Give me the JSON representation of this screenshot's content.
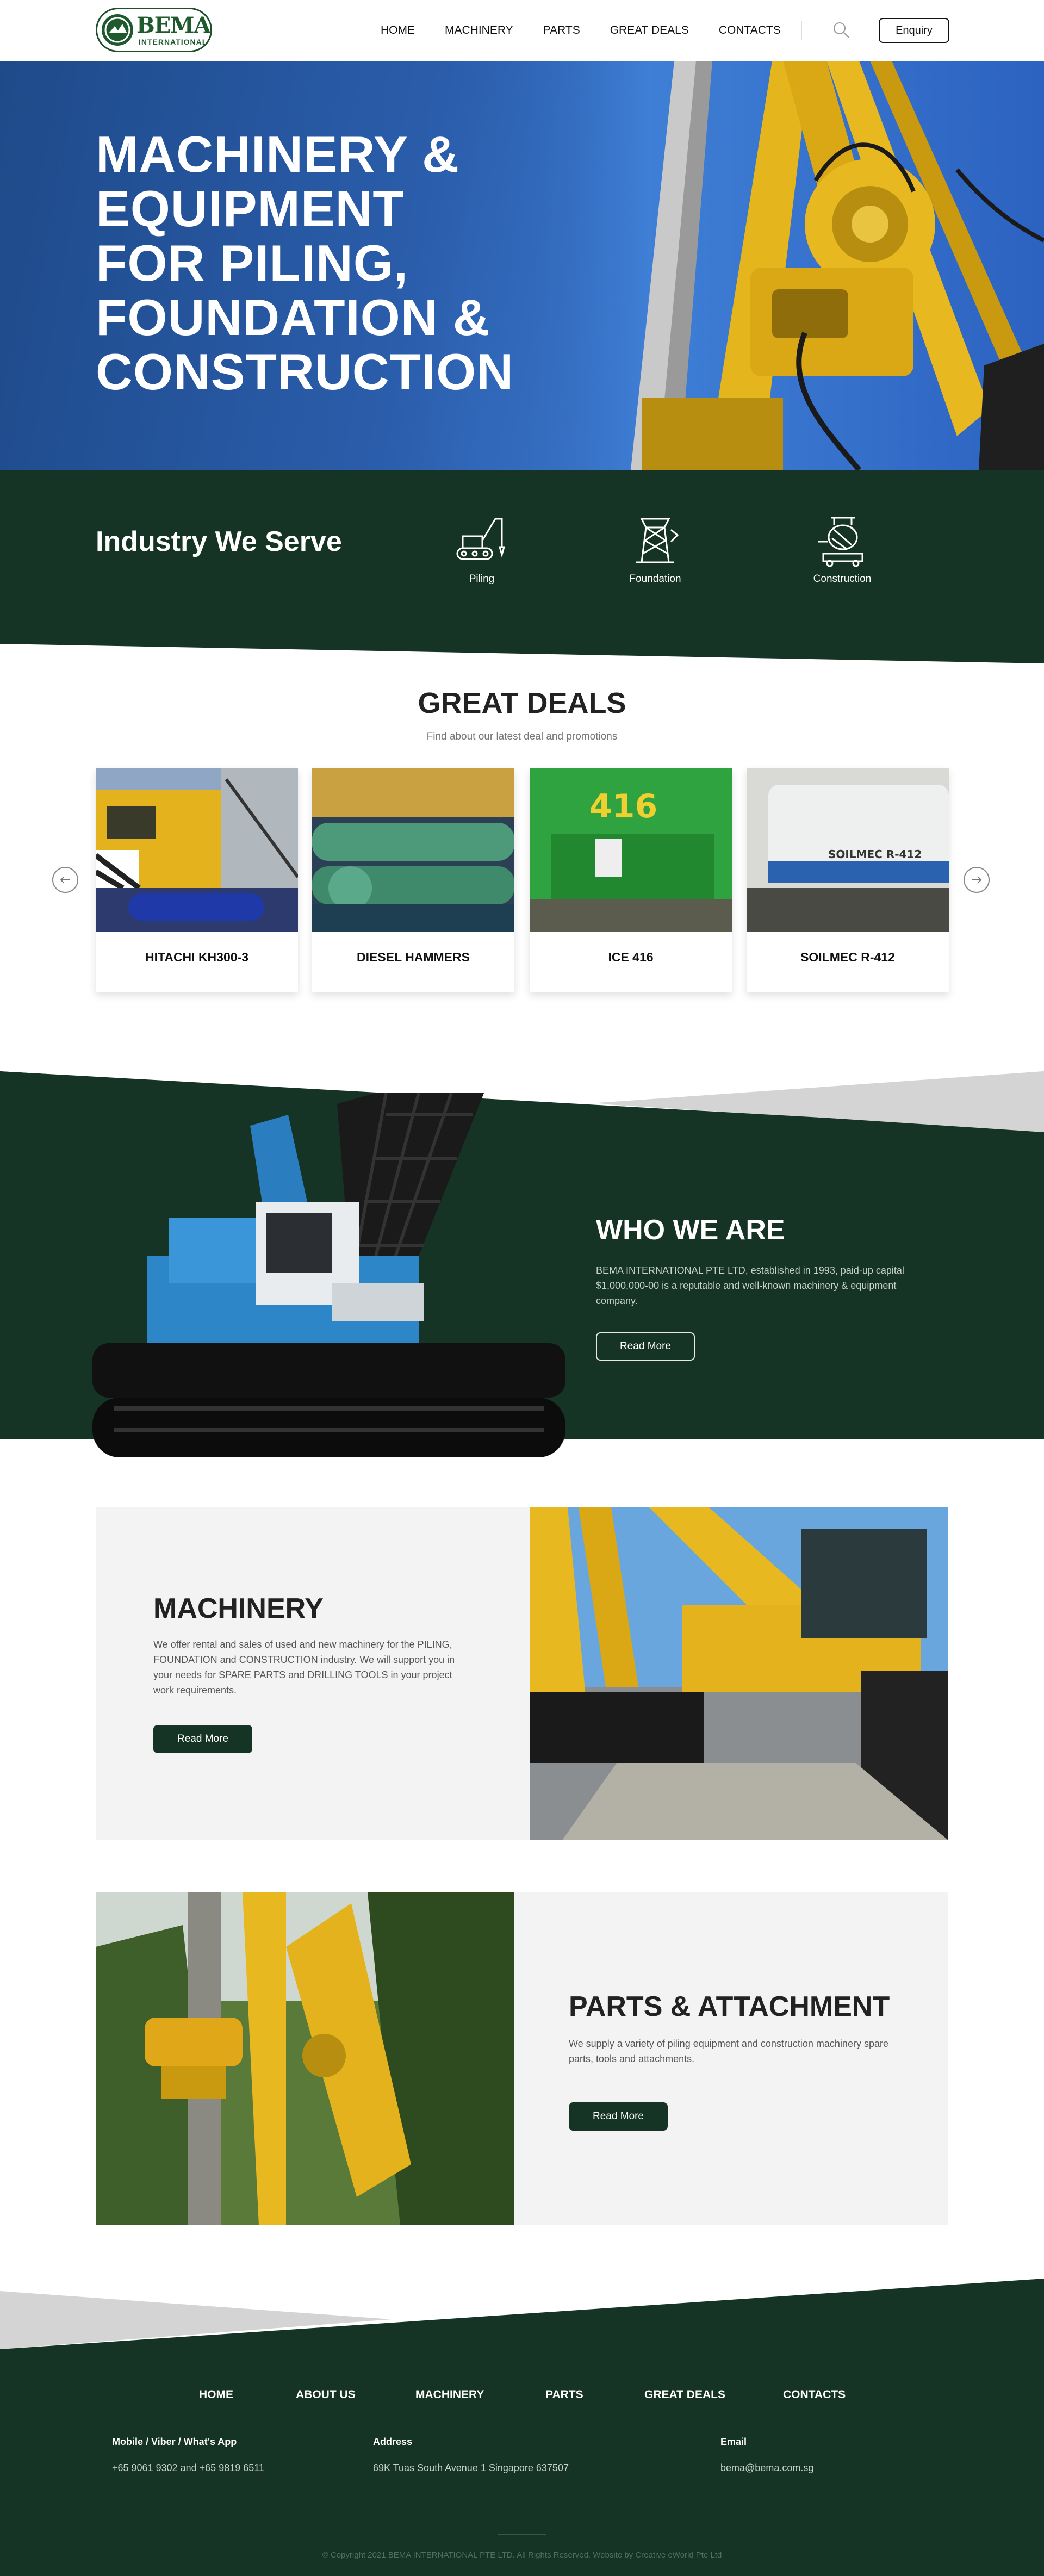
{
  "header": {
    "logo_word": "BEMA",
    "logo_sub": "INTERNATIONAL",
    "nav": [
      "HOME",
      "MACHINERY",
      "PARTS",
      "GREAT DEALS",
      "CONTACTS"
    ],
    "enquiry_label": "Enquiry",
    "search_icon": "search-icon"
  },
  "hero": {
    "lines": [
      "MACHINERY &",
      "EQUIPMENT",
      "FOR PILING,",
      "FOUNDATION &",
      "CONSTRUCTION"
    ]
  },
  "industry": {
    "title": "Industry We Serve",
    "items": [
      {
        "label": "Piling",
        "icon": "piling-rig-icon"
      },
      {
        "label": "Foundation",
        "icon": "foundation-tower-icon"
      },
      {
        "label": "Construction",
        "icon": "concrete-mixer-icon"
      }
    ]
  },
  "deals": {
    "title": "GREAT DEALS",
    "subtitle": "Find about our latest deal and promotions",
    "items": [
      {
        "name": "HITACHI KH300-3"
      },
      {
        "name": "DIESEL HAMMERS"
      },
      {
        "name": "ICE 416",
        "image_text": "416"
      },
      {
        "name": "SOILMEC R-412",
        "image_text": "SOILMEC R-412"
      }
    ]
  },
  "who": {
    "title": "WHO WE ARE",
    "text": "BEMA INTERNATIONAL PTE LTD, established in 1993, paid-up capital $1,000,000-00 is a reputable and well-known machinery & equipment company.",
    "button": "Read More"
  },
  "machinery": {
    "title": "MACHINERY",
    "text": "We offer rental and sales of used and new machinery for the PILING, FOUNDATION and CONSTRUCTION industry. We will support you in your needs for SPARE PARTS and DRILLING TOOLS in your project work requirements.",
    "button": "Read More"
  },
  "parts": {
    "title": "PARTS & ATTACHMENT",
    "text": "We supply a variety of piling equipment and construction machinery spare parts, tools and attachments.",
    "button": "Read More"
  },
  "footer": {
    "nav": [
      "HOME",
      "ABOUT US",
      "MACHINERY",
      "PARTS",
      "GREAT DEALS",
      "CONTACTS"
    ],
    "mobile_label": "Mobile / Viber / What's App",
    "mobile_value": "+65 9061 9302 and +65 9819 6511",
    "address_label": "Address",
    "address_value": "69K Tuas South Avenue 1 Singapore 637507",
    "email_label": "Email",
    "email_value": "bema@bema.com.sg",
    "copyright": "© Copyright 2021 BEMA INTERNATIONAL PTE LTD. All Rights Reserved. Website by Creative eWorld Pte Ltd"
  },
  "colors": {
    "dark_green": "#163426",
    "hero_blue": "#2a5dab",
    "machine_yellow": "#e8b820",
    "panel_grey": "#f3f3f3"
  }
}
